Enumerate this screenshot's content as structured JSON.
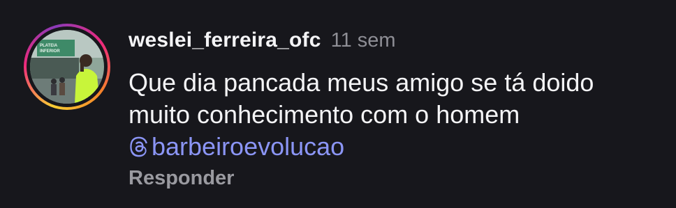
{
  "comment": {
    "username": "weslei_ferreira_ofc",
    "time": "11 sem",
    "text_line_1": "Que dia pancada meus amigo se tá doido",
    "text_line_2": "muito conhecimento com o homem",
    "mention": "barbeiroevolucao",
    "reply_label": "Responder"
  },
  "avatar": {
    "sign_text_1": "PLATEIA",
    "sign_text_2": "INFERIOR"
  },
  "colors": {
    "background": "#17171c",
    "text": "#f4f4f6",
    "muted": "#8e8e95",
    "mention": "#8b95f5",
    "shirt": "#c8f53a"
  }
}
